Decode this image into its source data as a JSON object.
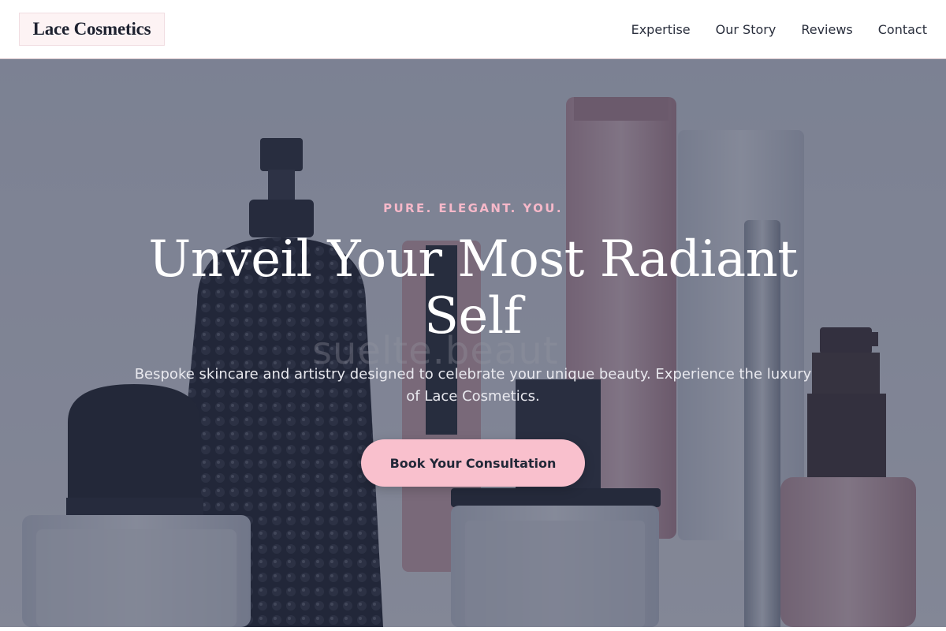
{
  "header": {
    "logo_text": "Lace Cosmetics",
    "nav": [
      {
        "label": "Expertise"
      },
      {
        "label": "Our Story"
      },
      {
        "label": "Reviews"
      },
      {
        "label": "Contact"
      }
    ]
  },
  "hero": {
    "eyebrow": "PURE. ELEGANT. YOU.",
    "headline": "Unveil Your Most Radiant Self",
    "watermark": "suelte.beaut",
    "subtitle": "Bespoke skincare and artistry designed to celebrate your unique beauty. Experience the luxury of Lace Cosmetics.",
    "cta_label": "Book Your Consultation"
  },
  "colors": {
    "accent_pink": "#f9c0cd",
    "eyebrow_pink": "#f6b8c9",
    "text_dark": "#1e2230",
    "overlay": "#2e364e"
  }
}
